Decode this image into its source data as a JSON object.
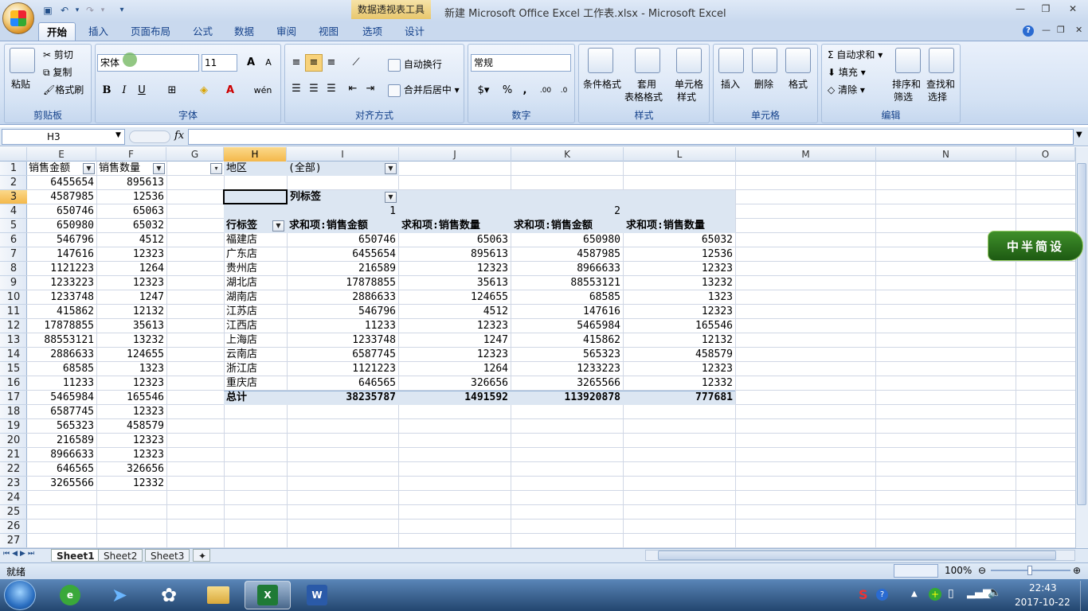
{
  "window": {
    "title": "新建 Microsoft Office Excel 工作表.xlsx - Microsoft Excel",
    "context_tab_title": "数据透视表工具"
  },
  "tabs": [
    "开始",
    "插入",
    "页面布局",
    "公式",
    "数据",
    "审阅",
    "视图",
    "选项",
    "设计"
  ],
  "ribbon": {
    "clipboard": {
      "label": "剪贴板",
      "paste": "粘贴",
      "cut": "剪切",
      "copy": "复制",
      "format_painter": "格式刷"
    },
    "font": {
      "label": "字体",
      "name": "宋体",
      "size": "11"
    },
    "alignment": {
      "label": "对齐方式",
      "wrap": "自动换行",
      "merge": "合并后居中"
    },
    "number": {
      "label": "数字",
      "format": "常规"
    },
    "styles": {
      "label": "样式",
      "cond": "条件格式",
      "table_1": "套用",
      "table_2": "表格格式",
      "cell_1": "单元格",
      "cell_2": "样式"
    },
    "cells": {
      "label": "单元格",
      "insert": "插入",
      "delete": "删除",
      "format": "格式"
    },
    "editing": {
      "label": "编辑",
      "autosum": "自动求和",
      "fill": "填充",
      "clear": "清除",
      "sort_1": "排序和",
      "sort_2": "筛选",
      "find_1": "查找和",
      "find_2": "选择"
    }
  },
  "formula_bar": {
    "name_box": "H3",
    "fx": "fx"
  },
  "columns": [
    {
      "id": "E"
    },
    {
      "id": "F"
    },
    {
      "id": "G"
    },
    {
      "id": "H"
    },
    {
      "id": "I"
    },
    {
      "id": "J"
    },
    {
      "id": "K"
    },
    {
      "id": "L"
    },
    {
      "id": "M"
    },
    {
      "id": "N"
    },
    {
      "id": "O"
    }
  ],
  "rows": [
    "1",
    "2",
    "3",
    "4",
    "5",
    "6",
    "7",
    "8",
    "9",
    "10",
    "11",
    "12",
    "13",
    "14",
    "15",
    "16",
    "17",
    "18",
    "19",
    "20",
    "21",
    "22",
    "23",
    "24",
    "25",
    "26",
    "27"
  ],
  "source": {
    "header_e": "销售金额",
    "header_f": "销售数量",
    "e": [
      "6455654",
      "4587985",
      "650746",
      "650980",
      "546796",
      "147616",
      "1121223",
      "1233223",
      "1233748",
      "415862",
      "17878855",
      "88553121",
      "2886633",
      "68585",
      "11233",
      "5465984",
      "6587745",
      "565323",
      "216589",
      "8966633",
      "646565",
      "3265566"
    ],
    "f": [
      "895613",
      "12536",
      "65063",
      "65032",
      "4512",
      "12323",
      "1264",
      "12323",
      "1247",
      "12132",
      "35613",
      "13232",
      "124655",
      "1323",
      "12323",
      "165546",
      "12323",
      "458579",
      "12323",
      "12323",
      "326656",
      "12332"
    ]
  },
  "pivot": {
    "filter_label": "地区",
    "filter_value": "(全部)",
    "col_label": "列标签",
    "row_label": "行标签",
    "group1": "1",
    "group2": "2",
    "headers": [
      "求和项:销售金额",
      "求和项:销售数量",
      "求和项:销售金额",
      "求和项:销售数量"
    ],
    "rows": [
      {
        "name": "福建店",
        "v": [
          "650746",
          "65063",
          "650980",
          "65032"
        ]
      },
      {
        "name": "广东店",
        "v": [
          "6455654",
          "895613",
          "4587985",
          "12536"
        ]
      },
      {
        "name": "贵州店",
        "v": [
          "216589",
          "12323",
          "8966633",
          "12323"
        ]
      },
      {
        "name": "湖北店",
        "v": [
          "17878855",
          "35613",
          "88553121",
          "13232"
        ]
      },
      {
        "name": "湖南店",
        "v": [
          "2886633",
          "124655",
          "68585",
          "1323"
        ]
      },
      {
        "name": "江苏店",
        "v": [
          "546796",
          "4512",
          "147616",
          "12323"
        ]
      },
      {
        "name": "江西店",
        "v": [
          "11233",
          "12323",
          "5465984",
          "165546"
        ]
      },
      {
        "name": "上海店",
        "v": [
          "1233748",
          "1247",
          "415862",
          "12132"
        ]
      },
      {
        "name": "云南店",
        "v": [
          "6587745",
          "12323",
          "565323",
          "458579"
        ]
      },
      {
        "name": "浙江店",
        "v": [
          "1121223",
          "1264",
          "1233223",
          "12323"
        ]
      },
      {
        "name": "重庆店",
        "v": [
          "646565",
          "326656",
          "3265566",
          "12332"
        ]
      }
    ],
    "total_label": "总计",
    "totals": [
      "38235787",
      "1491592",
      "113920878",
      "777681"
    ]
  },
  "sheets": [
    "Sheet1",
    "Sheet2",
    "Sheet3"
  ],
  "status": {
    "ready": "就绪",
    "zoom": "100%"
  },
  "watermark": "中半简设",
  "clock": {
    "time": "22:43",
    "date": "2017-10-22"
  }
}
